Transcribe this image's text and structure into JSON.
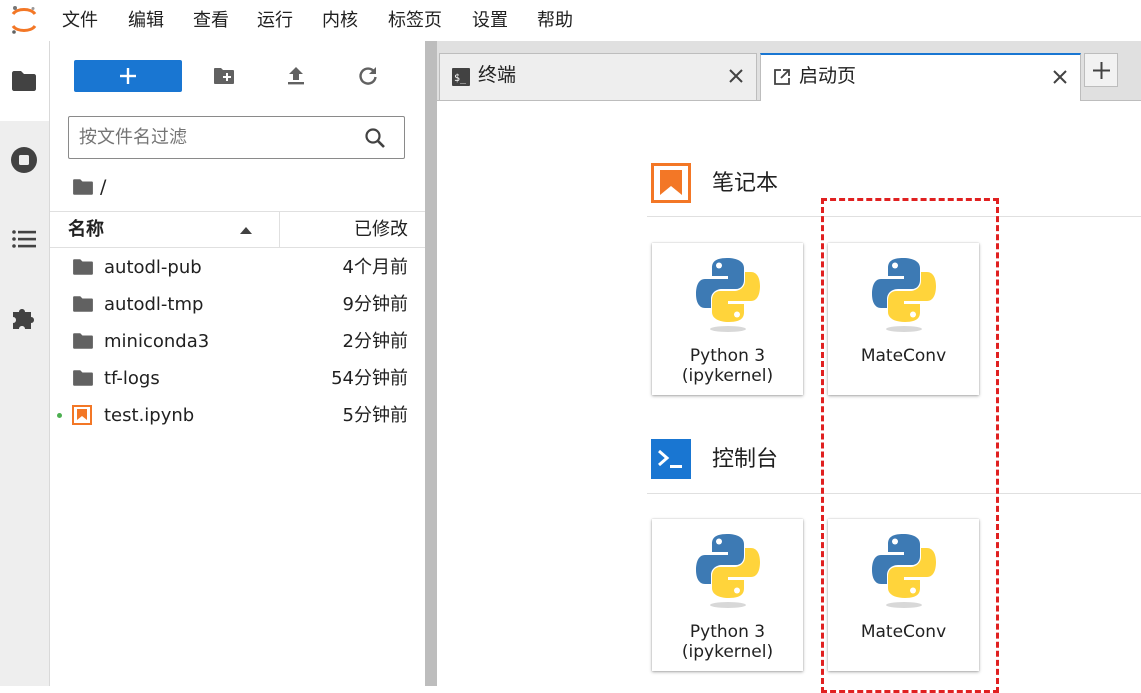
{
  "menu": [
    "文件",
    "编辑",
    "查看",
    "运行",
    "内核",
    "标签页",
    "设置",
    "帮助"
  ],
  "activity_bar": {
    "icons": [
      "folder-icon",
      "stop-circle-icon",
      "list-icon",
      "puzzle-icon"
    ]
  },
  "file_browser": {
    "new_button_icon": "plus-icon",
    "toolbar_icons": [
      "new-folder-icon",
      "upload-icon",
      "refresh-icon"
    ],
    "filter_placeholder": "按文件名过滤",
    "breadcrumb": "/",
    "columns": {
      "name": "名称",
      "modified": "已修改"
    },
    "files": [
      {
        "name": "autodl-pub",
        "modified": "4个月前",
        "type": "folder"
      },
      {
        "name": "autodl-tmp",
        "modified": "9分钟前",
        "type": "folder"
      },
      {
        "name": "miniconda3",
        "modified": "2分钟前",
        "type": "folder"
      },
      {
        "name": "tf-logs",
        "modified": "54分钟前",
        "type": "folder"
      },
      {
        "name": "test.ipynb",
        "modified": "5分钟前",
        "type": "notebook",
        "running": true
      }
    ]
  },
  "tabs": [
    {
      "label": "终端",
      "icon": "terminal-icon",
      "active": false
    },
    {
      "label": "启动页",
      "icon": "launch-icon",
      "active": true
    }
  ],
  "tab_add": "+",
  "launcher": {
    "notebook": {
      "title": "笔记本",
      "cards": [
        {
          "line1": "Python 3",
          "line2": "(ipykernel)"
        },
        {
          "line1": "MateConv",
          "line2": ""
        }
      ]
    },
    "console": {
      "title": "控制台",
      "cards": [
        {
          "line1": "Python 3",
          "line2": "(ipykernel)"
        },
        {
          "line1": "MateConv",
          "line2": ""
        }
      ]
    }
  },
  "colors": {
    "accent": "#1976d2",
    "notebook_orange": "#f37726",
    "annotation_red": "#e02020",
    "python_blue": "#3776ab",
    "python_yellow": "#ffd43b"
  }
}
